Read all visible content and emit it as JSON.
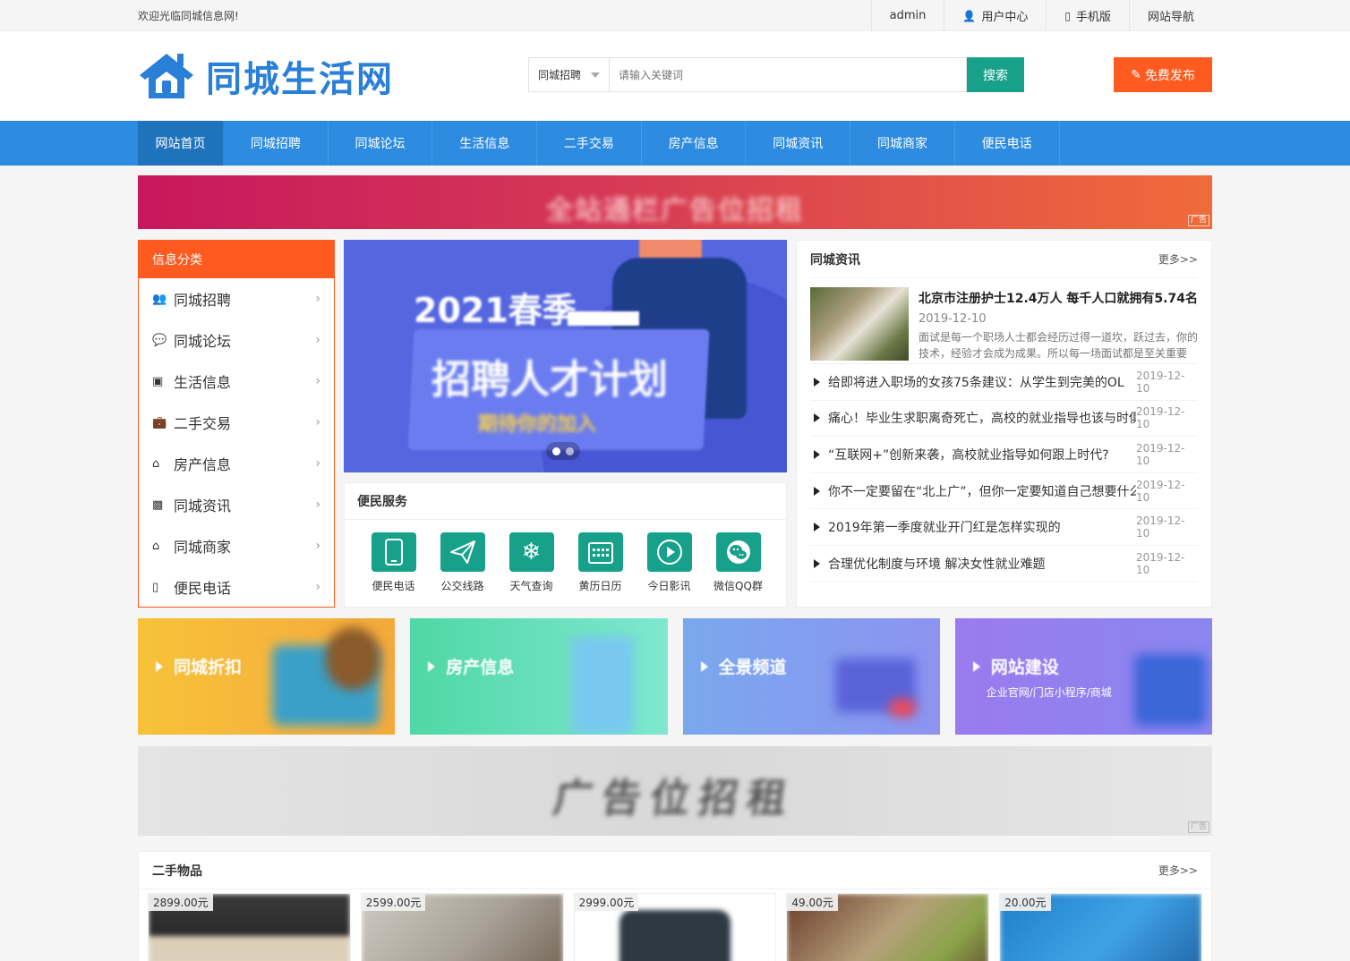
{
  "topbar": {
    "welcome": "欢迎光临同城信息网!",
    "links": [
      {
        "label": "admin",
        "icon": ""
      },
      {
        "label": "用户中心",
        "icon": "user-icon"
      },
      {
        "label": "手机版",
        "icon": "mobile-icon"
      },
      {
        "label": "网站导航",
        "icon": ""
      }
    ]
  },
  "header": {
    "logo_text": "同城生活网",
    "search": {
      "category": "同城招聘",
      "placeholder": "请输入关键词",
      "button": "搜索"
    },
    "publish_label": "免费发布"
  },
  "nav": [
    "网站首页",
    "同城招聘",
    "同城论坛",
    "生活信息",
    "二手交易",
    "房产信息",
    "同城资讯",
    "同城商家",
    "便民电话"
  ],
  "banner_ad": {
    "text": "全站通栏广告位招租",
    "tag": "广告"
  },
  "categories": {
    "title": "信息分类",
    "items": [
      {
        "label": "同城招聘",
        "icon": "recruit-icon"
      },
      {
        "label": "同城论坛",
        "icon": "chat-icon"
      },
      {
        "label": "生活信息",
        "icon": "note-icon"
      },
      {
        "label": "二手交易",
        "icon": "bag-icon"
      },
      {
        "label": "房产信息",
        "icon": "house-icon"
      },
      {
        "label": "同城资讯",
        "icon": "news-icon"
      },
      {
        "label": "同城商家",
        "icon": "shop-icon"
      },
      {
        "label": "便民电话",
        "icon": "phone-icon"
      }
    ]
  },
  "slider": {
    "headline": "2021春季",
    "main": "招聘人才计划",
    "sub": "期待你的加入"
  },
  "services": {
    "title": "便民服务",
    "items": [
      {
        "label": "便民电话",
        "icon": "phone-icon"
      },
      {
        "label": "公交线路",
        "icon": "paper-plane-icon"
      },
      {
        "label": "天气查询",
        "icon": "snowflake-icon"
      },
      {
        "label": "黄历日历",
        "icon": "calendar-icon"
      },
      {
        "label": "今日影讯",
        "icon": "play-icon"
      },
      {
        "label": "微信QQ群",
        "icon": "wechat-icon"
      }
    ]
  },
  "news": {
    "title": "同城资讯",
    "more": "更多>>",
    "featured": {
      "title": "北京市注册护士12.4万人 每千人口就拥有5.74名",
      "date": "2019-12-10",
      "excerpt": "面试是每一个职场人士都会经历过得一道坎，跃过去，你的技术，经验才会成为成果。所以每一场面试都是至关重要"
    },
    "items": [
      {
        "title": "给即将进入职场的女孩75条建议：从学生到完美的OL",
        "date": "2019-12-10"
      },
      {
        "title": "痛心！毕业生求职离奇死亡，高校的就业指导也该与时俱进",
        "date": "2019-12-10"
      },
      {
        "title": "“互联网+”创新来袭，高校就业指导如何跟上时代?",
        "date": "2019-12-10"
      },
      {
        "title": "你不一定要留在“北上广”，但你一定要知道自己想要什么",
        "date": "2019-12-10"
      },
      {
        "title": "2019年第一季度就业开门红是怎样实现的",
        "date": "2019-12-10"
      },
      {
        "title": "合理优化制度与环境 解决女性就业难题",
        "date": "2019-12-10"
      }
    ]
  },
  "promos": [
    {
      "title": "同城折扣",
      "sub": ""
    },
    {
      "title": "房产信息",
      "sub": ""
    },
    {
      "title": "全景频道",
      "sub": ""
    },
    {
      "title": "网站建设",
      "sub": "企业官网/门店小程序/商城"
    }
  ],
  "grey_ad": {
    "text": "广告位招租",
    "tag": "广告"
  },
  "used": {
    "title": "二手物品",
    "more": "更多>>",
    "items": [
      {
        "price": "2899.00元"
      },
      {
        "price": "2599.00元"
      },
      {
        "price": "2999.00元"
      },
      {
        "price": "49.00元"
      },
      {
        "price": "20.00元"
      }
    ]
  }
}
